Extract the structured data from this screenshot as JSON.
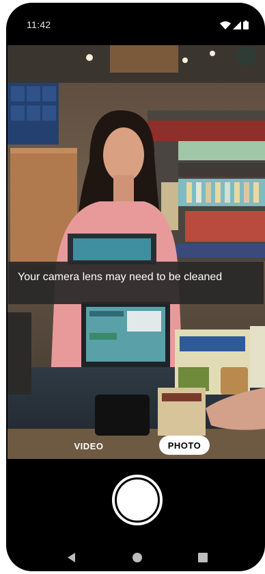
{
  "status_bar": {
    "time": "11:42",
    "icons": [
      "wifi-icon",
      "cellular-signal-icon",
      "battery-icon"
    ]
  },
  "camera": {
    "toast_message": "Your camera lens may need to be cleaned",
    "modes": {
      "video_label": "VIDEO",
      "photo_label": "PHOTO",
      "selected": "PHOTO"
    },
    "shutter_icon": "shutter-button"
  },
  "navigation": {
    "icons": [
      "back-icon",
      "home-icon",
      "recents-icon"
    ]
  },
  "colors": {
    "background": "#000000",
    "toast_background": "#282828",
    "selected_mode_background": "#ffffff",
    "text": "#ffffff"
  }
}
